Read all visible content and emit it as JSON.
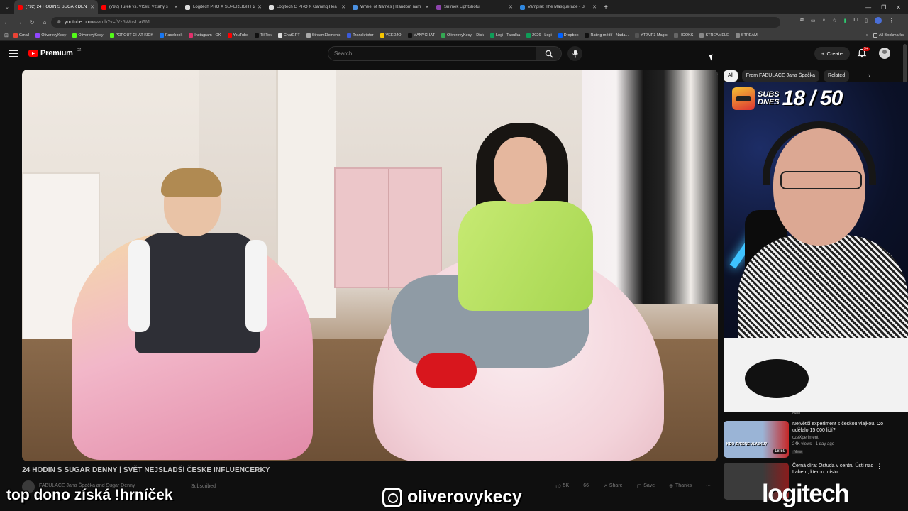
{
  "browser": {
    "tabs": [
      {
        "title": "(792) 24 HODIN S SUGAR DEN",
        "color": "#ff0000",
        "active": true
      },
      {
        "title": "(792) Turek vs. Vlček: Vztahy s",
        "color": "#ff0000",
        "active": false
      },
      {
        "title": "Logitech PRO X SUPERLIGHT 2",
        "color": "#dddddd",
        "active": false
      },
      {
        "title": "Logitech G PRO X Gaming Hea",
        "color": "#dddddd",
        "active": false
      },
      {
        "title": "Wheel of Names | Random nam",
        "color": "#4a90e2",
        "active": false
      },
      {
        "title": "Snímek Lightshotu",
        "color": "#8e44ad",
        "active": false
      },
      {
        "title": "Vampire: The Masquerade - Bl",
        "color": "#2e86de",
        "active": false
      }
    ],
    "new_tab": "+",
    "url_host": "youtube.com",
    "url_path": "/watch?v=fVz5WusUaGM",
    "bookmarks": [
      {
        "label": "Gmail",
        "color": "#ea4335"
      },
      {
        "label": "OliverovyKecy",
        "color": "#9146ff"
      },
      {
        "label": "OliverovyKecy",
        "color": "#53fc18"
      },
      {
        "label": "POPOUT CHAT KICK",
        "color": "#53fc18"
      },
      {
        "label": "Facebook",
        "color": "#1877f2"
      },
      {
        "label": "Instagram - OK",
        "color": "#e1306c"
      },
      {
        "label": "YouTube",
        "color": "#ff0000"
      },
      {
        "label": "TikTok",
        "color": "#111111"
      },
      {
        "label": "ChatGPT",
        "color": "#dddddd"
      },
      {
        "label": "StreamElements",
        "color": "#aaaaaa"
      },
      {
        "label": "Transkriptor",
        "color": "#3b5bdb"
      },
      {
        "label": "VEEDJO",
        "color": "#f7c600"
      },
      {
        "label": "MANYCHAT",
        "color": "#111111"
      },
      {
        "label": "OliverovyKecy – Disk",
        "color": "#34a853"
      },
      {
        "label": "Logi - Tabulka",
        "color": "#0f9d58"
      },
      {
        "label": "2026 - Logi",
        "color": "#0f9d58"
      },
      {
        "label": "Dropbox",
        "color": "#0061ff"
      },
      {
        "label": "Rating médií - Nada...",
        "color": "#111111"
      },
      {
        "label": "YT2MP3 Magic",
        "color": "#555555"
      },
      {
        "label": "HOOKS",
        "color": "#666666"
      },
      {
        "label": "STREAMELE",
        "color": "#888888"
      },
      {
        "label": "STREAM",
        "color": "#888888"
      }
    ],
    "more_bookmarks": "»",
    "all_bookmarks": "All Bookmarks"
  },
  "youtube": {
    "logo_text": "Premium",
    "country_code": "CZ",
    "search_placeholder": "Search",
    "create_label": "Create",
    "notif_count": "9+"
  },
  "video": {
    "title": "24 HODIN S SUGAR DENNY | SVĚT NEJSLADŠÍ ČESKÉ INFLUENCERKY",
    "channel": "FABULACE Jana Špačka and Sugar Denny",
    "subscribe_label": "Subscribed",
    "likes": "5K",
    "comments": "66",
    "share_label": "Share",
    "save_label": "Save",
    "thanks_label": "Thanks",
    "more": "···"
  },
  "sidebar": {
    "chips": [
      "All",
      "From FABULACE Jana Špačka",
      "Related"
    ],
    "chip_next": "›",
    "new_tag": "New",
    "recommendations": [
      {
        "title": "Největší experiment s českou vlajkou. Co udělalo 15 000 lidí?",
        "channel": "czeXperiment",
        "meta": "24K views · 1 day ago",
        "badge": "New",
        "duration": "18:59",
        "thumb_overlay": "KDO ZVEDNE VLAJKU?",
        "thumb_a": "#9ab4d6",
        "thumb_b": "#c62828"
      },
      {
        "title": "Černá díra: Ostuda v centru Ústí nad Labem, kterou místo ...",
        "channel": "",
        "meta": "",
        "badge": "",
        "duration": "",
        "thumb_overlay": "",
        "thumb_a": "#3b3b3b",
        "thumb_b": "#8a1c1c"
      }
    ]
  },
  "stream_overlay": {
    "subs_label_1": "SUBS",
    "subs_label_2": "DNES",
    "subs_current": "18",
    "subs_goal": "50",
    "subs_separator": "/",
    "bottom_left_text": "top dono získá !hrníček",
    "handle": "oliverovykecy",
    "sponsor": "logitech"
  }
}
